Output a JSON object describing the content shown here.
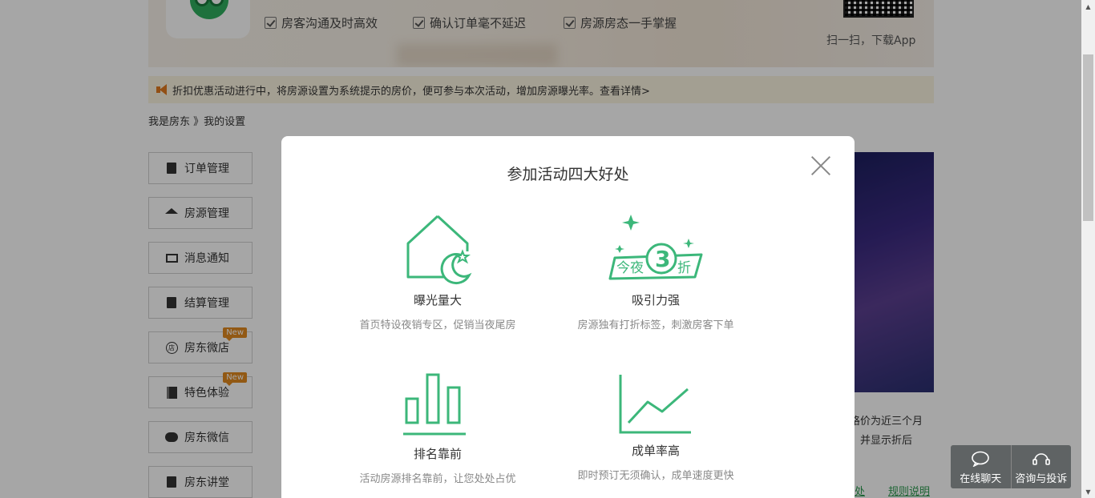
{
  "banner": {
    "features": [
      "房客沟通及时高效",
      "确认订单毫不延迟",
      "房源房态一手掌握"
    ],
    "qr_label": "扫一扫，下载App"
  },
  "notice": {
    "text": "折扣优惠活动进行中，将房源设置为系统提示的房价，便可参与本次活动，增加房源曝光率。查看详情>"
  },
  "breadcrumb": "我是房东 》我的设置",
  "sidebar": {
    "items": [
      {
        "label": "订单管理",
        "icon": "document-icon"
      },
      {
        "label": "房源管理",
        "icon": "house-icon"
      },
      {
        "label": "消息通知",
        "icon": "mail-icon"
      },
      {
        "label": "结算管理",
        "icon": "clipboard-icon"
      },
      {
        "label": "房东微店",
        "icon": "shop-icon",
        "badge": "New",
        "icon_glyph": "店"
      },
      {
        "label": "特色体验",
        "icon": "book-icon",
        "badge": "New"
      },
      {
        "label": "房东微信",
        "icon": "wechat-icon"
      },
      {
        "label": "房东讲堂",
        "icon": "document-icon"
      }
    ]
  },
  "right_panel": {
    "text_line1": "格价为近三个月",
    "text_line2": "，并显示折后",
    "link_partial": "处",
    "link_rules": "规则说明"
  },
  "modal": {
    "title": "参加活动四大好处",
    "benefits": [
      {
        "title": "曝光量大",
        "desc": "首页特设夜销专区，促销当夜尾房",
        "icon": "house-moon-icon"
      },
      {
        "title": "吸引力强",
        "desc": "房源独有打折标签，刺激房客下单",
        "icon": "discount-tag-icon",
        "tag_text_left": "今夜",
        "tag_number": "3",
        "tag_text_right": "折"
      },
      {
        "title": "排名靠前",
        "desc": "活动房源排名靠前，让您处处占优",
        "icon": "bar-chart-icon"
      },
      {
        "title": "成单率高",
        "desc": "即时预订无须确认，成单速度更快",
        "icon": "line-chart-icon"
      }
    ]
  },
  "chat_widget": {
    "online_chat": "在线聊天",
    "consult": "咨询与投诉"
  },
  "colors": {
    "accent_green": "#3cb77a",
    "notice_bg": "#fbf4e0",
    "badge_orange": "#e0891f"
  }
}
